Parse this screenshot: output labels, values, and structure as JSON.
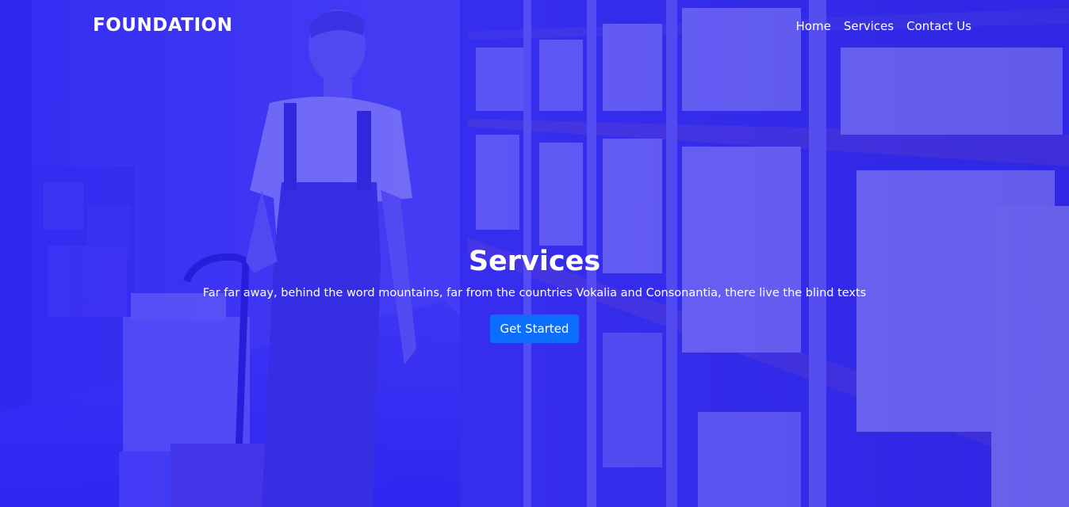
{
  "brand": "FOUNDATION",
  "nav": {
    "items": [
      {
        "label": "Home"
      },
      {
        "label": "Services"
      },
      {
        "label": "Contact Us"
      }
    ]
  },
  "hero": {
    "title": "Services",
    "subtitle": "Far far away, behind the word mountains, far from the countries Vokalia and Consonantia, there live the blind texts",
    "cta_label": "Get Started"
  },
  "colors": {
    "overlay": "#2f27f0",
    "button": "#0d6efd",
    "text": "#ffffff"
  }
}
